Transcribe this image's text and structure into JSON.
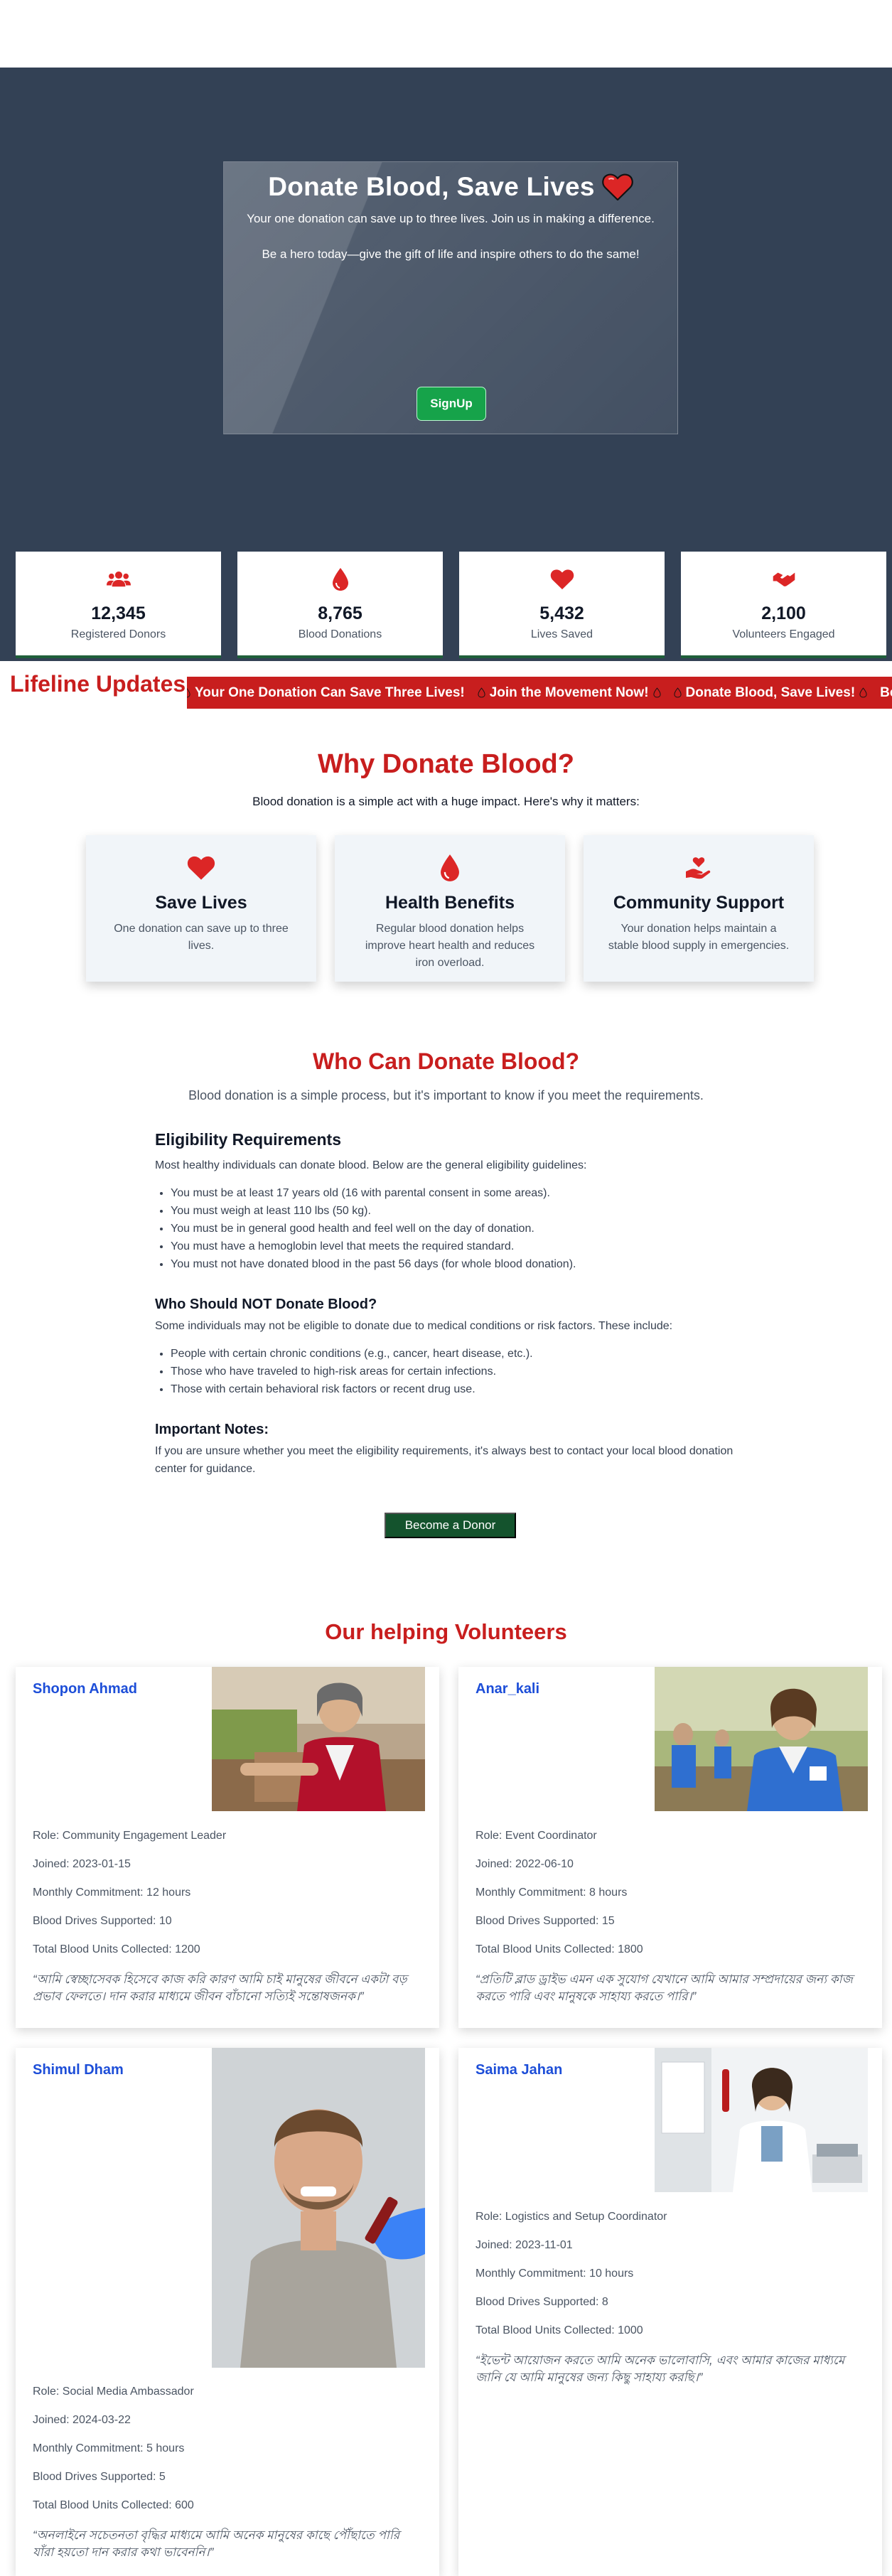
{
  "hero": {
    "title": "Donate Blood, Save Lives",
    "sub1": "Your one donation can save up to three lives. Join us in making a difference.",
    "sub2": "Be a hero today—give the gift of life and inspire others to do the same!",
    "signup": "SignUp"
  },
  "stats": [
    {
      "icon": "users-icon",
      "value": "12,345",
      "label": "Registered Donors"
    },
    {
      "icon": "blood-drop-icon",
      "value": "8,765",
      "label": "Blood Donations"
    },
    {
      "icon": "heart-icon",
      "value": "5,432",
      "label": "Lives Saved"
    },
    {
      "icon": "handshake-icon",
      "value": "2,100",
      "label": "Volunteers Engaged"
    }
  ],
  "ticker": {
    "title": "Lifeline Updates",
    "items": [
      "Your One Donation Can Save Three Lives!",
      "Join the Movement Now!",
      "Donate Blood, Save Lives!",
      "Be a Hero"
    ]
  },
  "why": {
    "title": "Why Donate Blood?",
    "subtitle": "Blood donation is a simple act with a huge impact. Here's why it matters:",
    "cards": [
      {
        "icon": "heart-icon",
        "title": "Save Lives",
        "text": "One donation can save up to three lives."
      },
      {
        "icon": "blood-drop-icon",
        "title": "Health Benefits",
        "text": "Regular blood donation helps improve heart health and reduces iron overload."
      },
      {
        "icon": "hand-heart-icon",
        "title": "Community Support",
        "text": "Your donation helps maintain a stable blood supply in emergencies."
      }
    ]
  },
  "who": {
    "title": "Who Can Donate Blood?",
    "subtitle": "Blood donation is a simple process, but it's important to know if you meet the requirements.",
    "elig_title": "Eligibility Requirements",
    "elig_intro": "Most healthy individuals can donate blood. Below are the general eligibility guidelines:",
    "elig_items": [
      "You must be at least 17 years old (16 with parental consent in some areas).",
      "You must weigh at least 110 lbs (50 kg).",
      "You must be in general good health and feel well on the day of donation.",
      "You must have a hemoglobin level that meets the required standard.",
      "You must not have donated blood in the past 56 days (for whole blood donation)."
    ],
    "not_title": "Who Should NOT Donate Blood?",
    "not_intro": "Some individuals may not be eligible to donate due to medical conditions or risk factors. These include:",
    "not_items": [
      "People with certain chronic conditions (e.g., cancer, heart disease, etc.).",
      "Those who have traveled to high-risk areas for certain infections.",
      "Those with certain behavioral risk factors or recent drug use."
    ],
    "notes_title": "Important Notes:",
    "notes_text": "If you are unsure whether you meet the eligibility requirements, it's always best to contact your local blood donation center for guidance.",
    "button": "Become a Donor"
  },
  "volunteers": {
    "title": "Our helping Volunteers",
    "people": [
      {
        "name": "Shopon Ahmad",
        "role": "Role: Community Engagement Leader",
        "joined": "Joined: 2023-01-15",
        "hours": "Monthly Commitment: 12 hours",
        "drives": "Blood Drives Supported: 10",
        "units": "Total Blood Units Collected: 1200",
        "quote": "“আমি স্বেচ্ছাসেবক হিসেবে কাজ করি কারণ আমি চাই মানুষের জীবনে একটা বড় প্রভাব ফেলতে। দান করার মাধ্যমে জীবন বাঁচানো সত্যিই সন্তোষজনক।”"
      },
      {
        "name": "Anar_kali",
        "role": "Role: Event Coordinator",
        "joined": "Joined: 2022-06-10",
        "hours": "Monthly Commitment: 8 hours",
        "drives": "Blood Drives Supported: 15",
        "units": "Total Blood Units Collected: 1800",
        "quote": "“প্রতিটি ব্লাড ড্রাইভ এমন এক সুযোগ যেখানে আমি আমার সম্প্রদায়ের জন্য কাজ করতে পারি এবং মানুষকে সাহায্য করতে পারি।”"
      },
      {
        "name": "Shimul Dham",
        "role": "Role: Social Media Ambassador",
        "joined": "Joined: 2024-03-22",
        "hours": "Monthly Commitment: 5 hours",
        "drives": "Blood Drives Supported: 5",
        "units": "Total Blood Units Collected: 600",
        "quote": "“অনলাইনে সচেতনতা বৃদ্ধির মাধ্যমে আমি অনেক মানুষের কাছে পৌঁছাতে পারি যাঁরা হয়তো দান করার কথা ভাবেননি।”"
      },
      {
        "name": "Saima Jahan",
        "role": "Role: Logistics and Setup Coordinator",
        "joined": "Joined: 2023-11-01",
        "hours": "Monthly Commitment: 10 hours",
        "drives": "Blood Drives Supported: 8",
        "units": "Total Blood Units Collected: 1000",
        "quote": "“ইভেন্ট আয়োজন করতে আমি অনেক ভালোবাসি, এবং আমার কাজের মাধ্যমে জানি যে আমি মানুষের জন্য কিছু সাহায্য করছি।”"
      }
    ]
  }
}
